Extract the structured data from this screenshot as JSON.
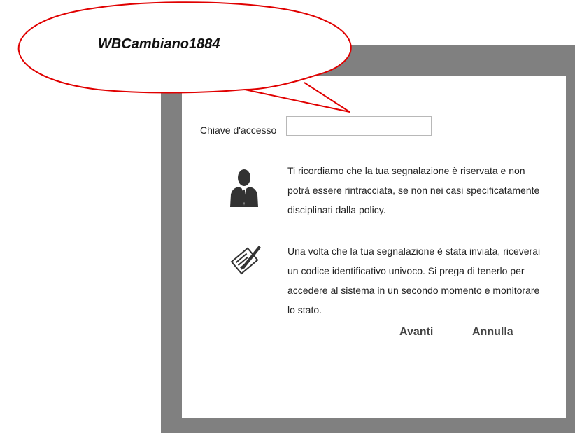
{
  "callout": {
    "text": "WBCambiano1884",
    "border_color": "#e00000"
  },
  "form": {
    "access_key_label": "Chiave d'accesso",
    "access_key_value": "",
    "access_key_placeholder": ""
  },
  "info": {
    "privacy_text": "Ti ricordiamo che la tua segnalazione è riservata e non potrà essere rintracciata, se non nei casi specificatamente disciplinati dalla policy.",
    "privacy_icon": "user-icon",
    "code_text": "Una volta che la tua segnalazione è stata inviata, riceverai un codice identificativo univoco. Si prega di tenerlo per accedere al sistema in un secondo momento e monitorare lo stato.",
    "code_icon": "signed-document-icon"
  },
  "actions": {
    "next_label": "Avanti",
    "cancel_label": "Annulla"
  },
  "colors": {
    "frame": "#808080",
    "dialog": "#ffffff",
    "button_text": "#444444"
  }
}
